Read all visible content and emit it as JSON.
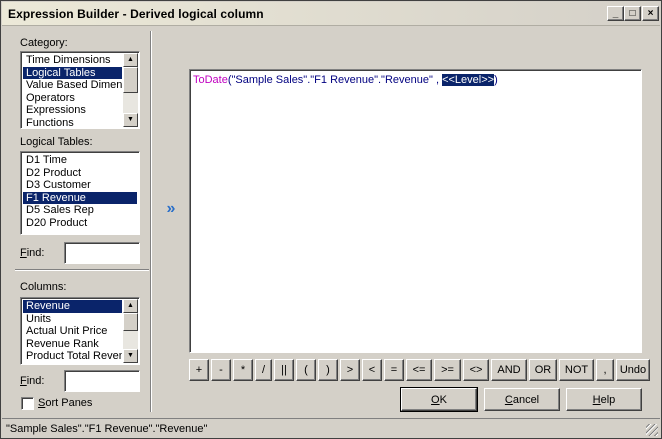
{
  "window": {
    "title": "Expression Builder - Derived logical column",
    "controls": {
      "minimize_icon": "_",
      "maximize_icon": "□",
      "close_icon": "×"
    }
  },
  "category": {
    "label": "Category:",
    "items": [
      "Time Dimensions",
      "Logical Tables",
      "Value Based Dimensions",
      "Operators",
      "Expressions",
      "Functions"
    ],
    "selected": "Logical Tables"
  },
  "logical_tables": {
    "label": "Logical Tables:",
    "items": [
      "D1 Time",
      "D2 Product",
      "D3 Customer",
      "F1 Revenue",
      "D5 Sales Rep",
      "D20 Product"
    ],
    "selected": "F1 Revenue"
  },
  "find_tables": {
    "label": "Find:",
    "value": ""
  },
  "columns": {
    "label": "Columns:",
    "items": [
      "Revenue",
      "Units",
      "Actual Unit Price",
      "Revenue Rank",
      "Product Total Revenue"
    ],
    "selected": "Revenue"
  },
  "find_columns": {
    "label": "Find:",
    "value": ""
  },
  "sort_panes": {
    "label": "Sort Panes",
    "checked": false
  },
  "insert_arrow": {
    "icon": "double-chevron-right-icon",
    "glyph": "»"
  },
  "editor": {
    "function": "ToDate",
    "open": "(",
    "argument": "\"Sample Sales\".\"F1 Revenue\".\"Revenue\"",
    "separator": " , ",
    "placeholder": "<<Level>>",
    "close": ")"
  },
  "operators": [
    "+",
    "-",
    "*",
    "/",
    "||",
    "(",
    ")",
    ">",
    "<",
    "=",
    "<=",
    ">=",
    "<>",
    "AND",
    "OR",
    "NOT",
    ",",
    "Undo"
  ],
  "buttons": {
    "ok": "OK",
    "cancel": "Cancel",
    "help": "Help"
  },
  "status": {
    "text": "\"Sample Sales\".\"F1 Revenue\".\"Revenue\""
  },
  "colors": {
    "selection": "#0a246a",
    "function": "#c000c0",
    "string": "#000080",
    "arrow": "#2a6fc9"
  }
}
